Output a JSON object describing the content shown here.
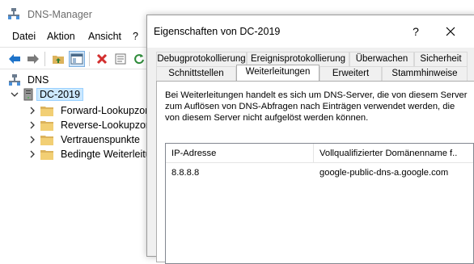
{
  "app": {
    "title": "DNS-Manager",
    "menu": [
      "Datei",
      "Aktion",
      "Ansicht",
      "?"
    ]
  },
  "toolbar": {
    "icons": [
      "back-arrow-icon",
      "forward-arrow-icon",
      "folder-up-icon",
      "show-hide-console-tree-icon",
      "delete-icon",
      "properties-icon",
      "refresh-icon"
    ]
  },
  "tree": {
    "root": "DNS",
    "server": "DC-2019",
    "children": [
      "Forward-Lookupzonen",
      "Reverse-Lookupzonen",
      "Vertrauenspunkte",
      "Bedingte Weiterleitungen"
    ]
  },
  "dialog": {
    "title": "Eigenschaften von DC-2019",
    "help": "?",
    "tabs_row1": [
      "Debugprotokollierung",
      "Ereignisprotokollierung",
      "Überwachen",
      "Sicherheit"
    ],
    "tabs_row2": [
      "Schnittstellen",
      "Weiterleitungen",
      "Erweitert",
      "Stammhinweise"
    ],
    "active_tab": "Weiterleitungen",
    "description": "Bei Weiterleitungen handelt es sich um DNS-Server, die von diesem Server zum Auflösen von DNS-Abfragen nach Einträgen verwendet werden, die von diesem Server nicht aufgelöst werden können.",
    "table": {
      "columns": [
        "IP-Adresse",
        "Vollqualifizierter Domänenname f..."
      ],
      "rows": [
        {
          "ip": "8.8.8.8",
          "fqdn": "google-public-dns-a.google.com"
        }
      ]
    }
  },
  "colors": {
    "selection": "#cce8ff",
    "folder": "#dcb35c",
    "delete": "#d32f2f",
    "arrow_blue": "#1e73c9"
  }
}
